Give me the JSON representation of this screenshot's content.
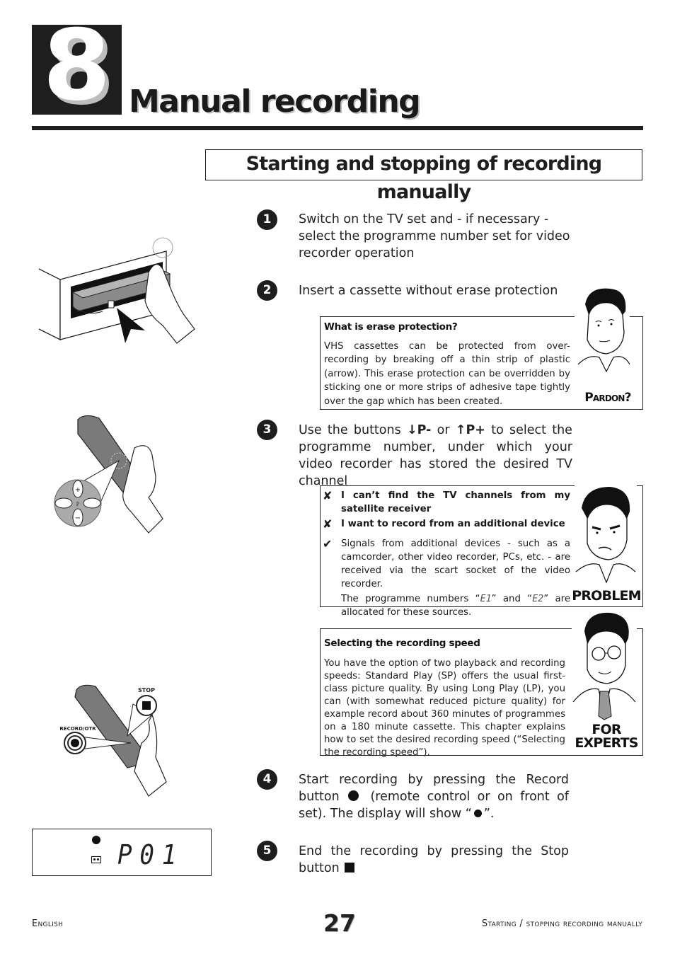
{
  "chapter": {
    "number": "8",
    "title": "Manual recording"
  },
  "section": {
    "title": "Starting and stopping of recording manually"
  },
  "steps": [
    {
      "number": "1",
      "text": "Switch on the TV set and - if necessary - select the programme number set for video recorder operation"
    },
    {
      "number": "2",
      "text": "Insert a cassette without erase protection"
    },
    {
      "number": "3",
      "text_before": "Use the buttons",
      "button_down": "P-",
      "text_or": "or",
      "button_up": "P+",
      "text_after": "to select the programme number, under which your video recorder has stored the desired TV channel"
    },
    {
      "number": "4",
      "text_before": "Start recording by pressing the Record button",
      "text_middle": "(remote control or on front of set). The display will show “",
      "text_after": "”."
    },
    {
      "number": "5",
      "text": "End the recording by pressing the Stop button"
    }
  ],
  "pardon_box": {
    "heading": "What is erase protection?",
    "body": "VHS cassettes can be protected from over-recording by breaking off a thin strip of plastic (arrow). This erase protection can be overridden by sticking one or more strips of adhesive tape tightly over the gap which has been created.",
    "badge": "Pardon?"
  },
  "problem_box": {
    "items": [
      {
        "marker": "✘",
        "text": "I can’t find the TV channels from my satellite receiver",
        "bold": true
      },
      {
        "marker": "✘",
        "text": "I want to record from an additional device",
        "bold": true
      },
      {
        "marker": "✔",
        "text": "Signals from additional devices - such as a camcorder, other video recorder, PCs, etc. - are received via the scart socket of the video recorder.",
        "bold": false
      }
    ],
    "note_before": "The programme numbers “",
    "code1": "E1",
    "note_mid": "” and “",
    "code2": "E2",
    "note_after": "” are allocated for these sources.",
    "badge": "PROBLEM"
  },
  "experts_box": {
    "heading": "Selecting the recording speed",
    "body": "You have the option of two playback and recording speeds: Standard Play (SP) offers the usual first-class picture quality. By using Long Play (LP), you can (with somewhat reduced picture quality) for example record about 360 minutes of programmes on a 180 minute cassette. This chapter explains how to set the desired recording speed (“Selecting the recording speed”).",
    "badge_line1": "FOR",
    "badge_line2": "EXPERTS"
  },
  "illustrations": {
    "remote_stop_label": "STOP",
    "remote_record_label": "RECORD/OTR",
    "keypad_label": "P"
  },
  "display": {
    "text": "P01",
    "icons": [
      "record-dot",
      "cassette"
    ]
  },
  "footer": {
    "left": "English",
    "page": "27",
    "right": "Starting / stopping recording  manually"
  }
}
